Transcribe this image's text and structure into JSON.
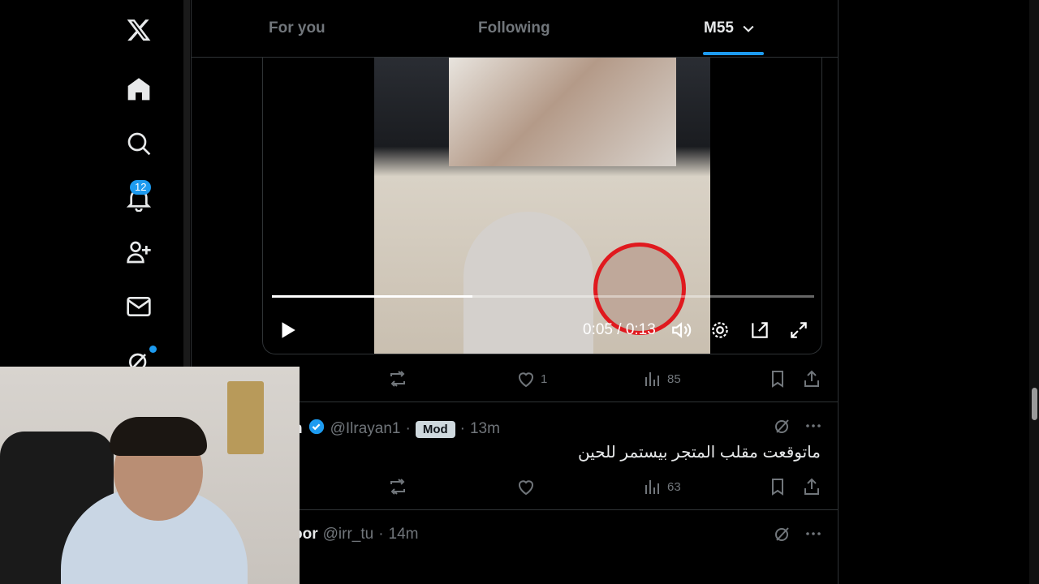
{
  "nav": {
    "notifications_badge": "12"
  },
  "tabs": {
    "for_you": "For you",
    "following": "Following",
    "active": "M55"
  },
  "video": {
    "timecode": "0:05 / 0:13",
    "progress": 0.37
  },
  "post1_actions": {
    "likes": "1",
    "views": "85"
  },
  "post2": {
    "name_partial": "n",
    "handle": "@Ilrayan1",
    "separator": "·",
    "badge": "Mod",
    "time": "13m",
    "text": "ماتوقعت مقلب المتجر بيستمر للحين",
    "views": "63"
  },
  "post3": {
    "name_partial": "oor",
    "handle": "@irr_tu",
    "separator": "·",
    "time": "14m"
  },
  "colors": {
    "accent": "#1d9bf0",
    "muted": "#71767b",
    "border": "#2f3336"
  }
}
